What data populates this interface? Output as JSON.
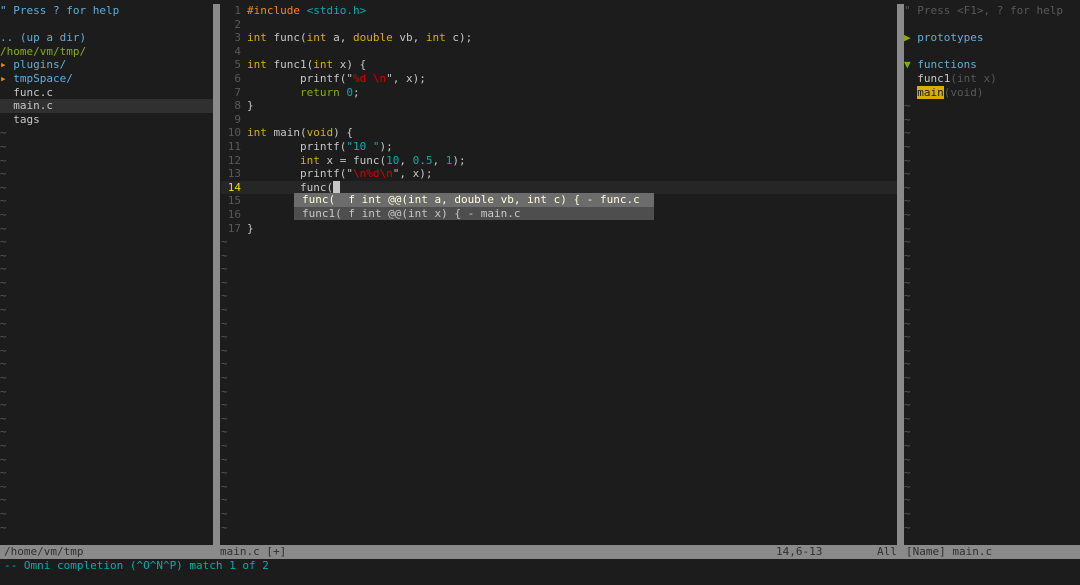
{
  "explorer": {
    "help": "\" Press ? for help",
    "updir": ".. (up a dir)",
    "cwd": "/home/vm/tmp/",
    "entries": [
      {
        "arrow": "▸ ",
        "name": "plugins/"
      },
      {
        "arrow": "▸ ",
        "name": "tmpSpace/"
      },
      {
        "name": "func.c"
      },
      {
        "name": "main.c"
      },
      {
        "name": "tags"
      }
    ],
    "tilde": "~"
  },
  "editor": {
    "line_numbers": [
      "1",
      "2",
      "3",
      "4",
      "5",
      "6",
      "7",
      "8",
      "9",
      "10",
      "11",
      "12",
      "13",
      "14",
      "15",
      "16",
      "17"
    ],
    "tilde": "~",
    "code": {
      "l1_include": "#include",
      "l1_header": " <stdio.h>",
      "l3_int": "int",
      "l3_mid": " func(",
      "l3_int2": "int",
      "l3_a": " a, ",
      "l3_double": "double",
      "l3_vb": " vb, ",
      "l3_int3": "int",
      "l3_end": " c);",
      "l5_int": "int",
      "l5_mid": " func1(",
      "l5_int2": "int",
      "l5_end": " x) {",
      "l6_indent": "        printf(\"",
      "l6_fmt": "%d \\n",
      "l6_end": "\", x);",
      "l7_indent": "        ",
      "l7_return": "return",
      "l7_sp": " ",
      "l7_zero": "0",
      "l7_end": ";",
      "l8": "}",
      "l10_int": "int",
      "l10_mid": " main(",
      "l10_void": "void",
      "l10_end": ") {",
      "l11_indent": "        printf(",
      "l11_str": "\"10 \"",
      "l11_end": ");",
      "l12_indent": "        ",
      "l12_int": "int",
      "l12_mid": " x = func(",
      "l12_n1": "10",
      "l12_c1": ", ",
      "l12_n2": "0.5",
      "l12_c2": ", ",
      "l12_n3": "1",
      "l12_end": ");",
      "l13_indent": "        printf(\"",
      "l13_fmt": "\\n%d\\n",
      "l13_end": "\", x);",
      "l14": "        func(",
      "l17": "}"
    }
  },
  "popup": {
    "items": [
      "func(  f int @@(int a, double vb, int c) { - func.c",
      "func1( f int @@(int x) { - main.c"
    ],
    "selected_index": 0
  },
  "tagbar": {
    "help": "\" Press <F1>, ? for help",
    "prototypes_marker": "▶ ",
    "prototypes_label": "prototypes",
    "functions_marker": "▼ ",
    "functions_label": "functions",
    "items": [
      {
        "name": "func1",
        "sig": "(int x)"
      },
      {
        "name": "main",
        "sig": "(void)"
      }
    ],
    "tilde": "~"
  },
  "status": {
    "left_path": "/home/vm/tmp",
    "editor_file": "main.c [+]",
    "editor_pos": "14,6-13",
    "editor_scroll": "All",
    "right": "[Name] main.c"
  },
  "cmdline": "-- Omni completion (^O^N^P) match 1 of 2",
  "colors": {
    "background": "#1c1c1c",
    "status_bg": "#8a8a8a",
    "accent_orange": "#ff8700",
    "accent_blue": "#5fafd7",
    "accent_green": "#87af00",
    "cursor_line_number": "#ffd700"
  }
}
